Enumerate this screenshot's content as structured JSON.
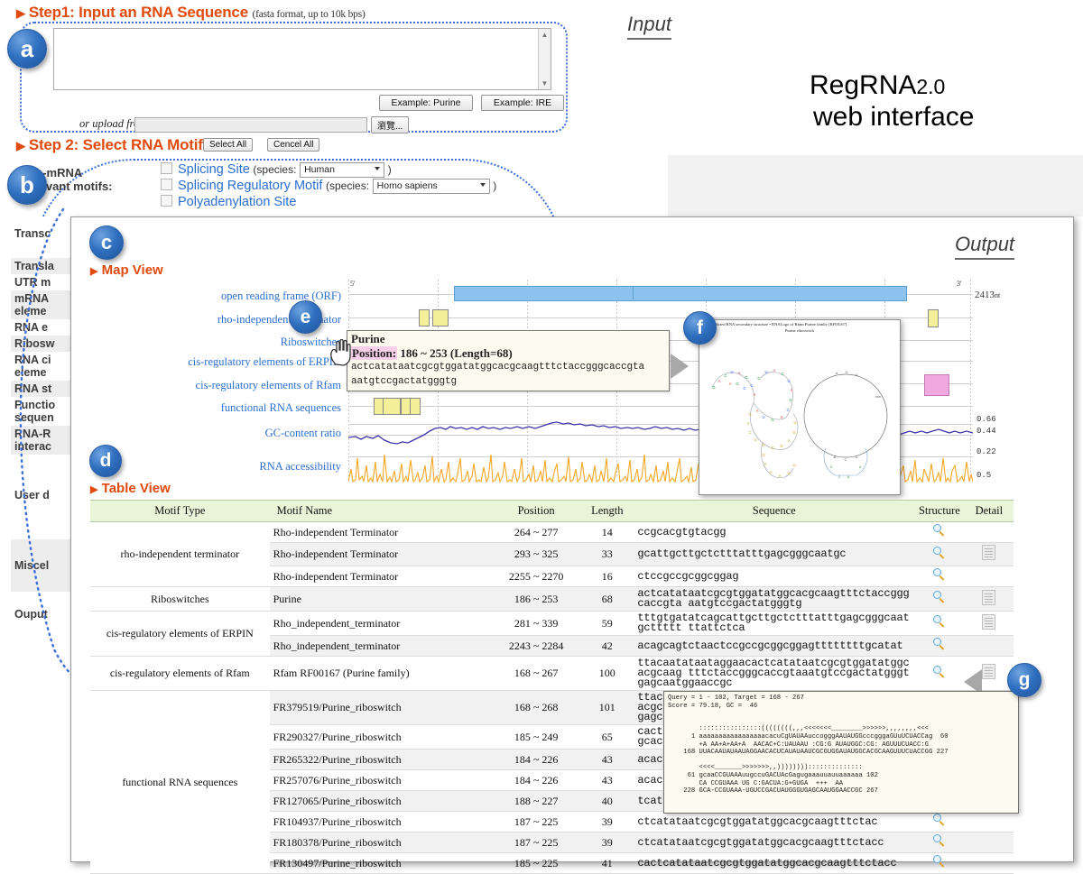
{
  "page": {
    "brand_line1": "RegRNA",
    "brand_version": "2.0",
    "brand_line2": "web interface",
    "input_header": "Input",
    "output_header": "Output"
  },
  "step1": {
    "triangle": "▶",
    "title": "Step1: Input an RNA Sequence",
    "note": "(fasta format, up to 10k bps)",
    "textarea_value": "",
    "textarea_placeholder": "",
    "example_purine": "Example: Purine",
    "example_ire": "Example: IRE",
    "upload_label": "or upload from:",
    "upload_value": "",
    "browse_button": "瀏覽..."
  },
  "step2": {
    "triangle": "▶",
    "title": "Step 2: Select RNA Motifs",
    "select_all": "Select All",
    "cancel_all": "Cencel All",
    "group_label_line1": "e-mRNA",
    "group_label_line2": "levant motifs:",
    "motifs": [
      {
        "label": "Splicing Site",
        "species_prefix": "(species:",
        "species_value": "Human",
        "species_suffix": ")",
        "checked": false
      },
      {
        "label": "Splicing Regulatory Motif",
        "species_prefix": "(species:",
        "species_value": "Homo sapiens",
        "species_suffix": ")",
        "checked": false
      },
      {
        "label": "Polyadenylation Site",
        "species_prefix": "",
        "species_value": "",
        "species_suffix": "",
        "checked": false
      }
    ]
  },
  "sidebar": {
    "items": [
      {
        "label": "Transc",
        "shaded": false
      },
      {
        "label": "Transla",
        "shaded": true
      },
      {
        "label": "UTR m",
        "shaded": false
      },
      {
        "label": "mRNA\neleme",
        "shaded": true
      },
      {
        "label": "RNA e",
        "shaded": false
      },
      {
        "label": "Ribosw",
        "shaded": true
      },
      {
        "label": "RNA ci\neleme",
        "shaded": false
      },
      {
        "label": "RNA st",
        "shaded": true
      },
      {
        "label": "Functio\nsequen",
        "shaded": false
      },
      {
        "label": "RNA-R\ninterac",
        "shaded": true
      },
      {
        "label": "User d",
        "shaded": false
      },
      {
        "label": "Miscel",
        "shaded": true
      },
      {
        "label": "Ouput",
        "shaded": false
      }
    ]
  },
  "badges": [
    {
      "id": "a",
      "letter": "a"
    },
    {
      "id": "b",
      "letter": "b"
    },
    {
      "id": "c",
      "letter": "c"
    },
    {
      "id": "d",
      "letter": "d"
    },
    {
      "id": "e",
      "letter": "e"
    },
    {
      "id": "f",
      "letter": "f"
    },
    {
      "id": "g",
      "letter": "g"
    }
  ],
  "map_view": {
    "triangle": "▶",
    "title": "Map View",
    "five_prime": "5'",
    "three_prime": "3'",
    "length_label": "2413",
    "length_unit": "nt",
    "tracks": [
      {
        "name": "open reading frame (ORF)"
      },
      {
        "name": "rho-independent terminator"
      },
      {
        "name": "Riboswitches"
      },
      {
        "name": "cis-regulatory elements of ERPIN"
      },
      {
        "name": "cis-regulatory elements of Rfam"
      },
      {
        "name": "functional RNA sequences"
      },
      {
        "name": "GC-content ratio"
      },
      {
        "name": "RNA accessibility"
      }
    ],
    "gc_axis_ticks": [
      "0.66",
      "0.44",
      "0.22"
    ],
    "access_axis_ticks": [
      "0.5"
    ],
    "feature_colors": {
      "orf": "#8dc3ee",
      "terminator": "#f4f09a",
      "riboswitch": "#2ee0e8",
      "erpin": "#f2706e",
      "rfam": "#f0a8e0",
      "functional": "#f4f09a",
      "gc_line": "#3b34a8",
      "accessibility": "#f5a623"
    }
  },
  "tooltip_e": {
    "title": "Purine",
    "position_label": "Position:",
    "position_value": "186 ~ 253",
    "length_text": "(Length=68)",
    "sequence_line1": "actcatataatcgcgtggatatggcacgcaagtttctaccgggcaccgta",
    "sequence_line2": "aatgtccgactatgggtg"
  },
  "popup_f": {
    "header": "...of predicted RNA secondary structure   • RNALogo of Rfam Purine family (RF00167)",
    "subheader": "Purine riboswitch"
  },
  "popup_g": {
    "text": "Query = 1 - 102, Target = 168 - 267\nScore = 79.18, GC =  46\n\n\n        ::::::::::::::::((((((((,,,<<<<<<<________>>>>>>,,,,,,,,<<<\n      1 aaaaaaaaaaaaaaaaacacuCgUAUAAuccogggAAUAUGGcccgggaGUuUCUACCag  60\n        +A AA+A+AA+A  AACAC+C:UAUAAU :CG:G AUAUGGC:CG: AGUUUCUACC:G\n    168 UUACAAUAUAAUAGGAACACUCAUAUAAUCGCGUGGAUAUGGCACGCAAGUUUCUACCGG 227\n\n        <<<<_______>>>>>>>,,))))))))::::::::::::::\n     61 gcaaCCGUAAAuugccuGACUAcGagugaaauuauuaaaaaa 102\n        CA CCGUAAA UG C:GACUA:G+GUGA  +++  AA\n    228 GCA-CCGUAAA-UGUCCGACUAUGGGUGAGCAAUGGAACCGC 267"
  },
  "table_view": {
    "triangle": "▶",
    "title": "Table View",
    "columns": [
      "Motif Type",
      "Motif Name",
      "Position",
      "Length",
      "Sequence",
      "Structure",
      "Detail"
    ],
    "groups": [
      {
        "type": "rho-independent terminator",
        "rows": [
          {
            "name": "Rho-independent Terminator",
            "position": "264 ~ 277",
            "length": "14",
            "sequence": "ccgcacgtgtacgg",
            "structure": true,
            "detail": false
          },
          {
            "name": "Rho-independent Terminator",
            "position": "293 ~ 325",
            "length": "33",
            "sequence": "gcattgcttgctctttatttgagcgggcaatgc",
            "structure": true,
            "detail": true
          },
          {
            "name": "Rho-independent Terminator",
            "position": "2255 ~ 2270",
            "length": "16",
            "sequence": "ctccgccgcggcggag",
            "structure": true,
            "detail": false
          }
        ]
      },
      {
        "type": "Riboswitches",
        "rows": [
          {
            "name": "Purine",
            "position": "186 ~ 253",
            "length": "68",
            "sequence": "actcatataatcgcgtggatatggcacgcaagtttctaccgggcaccgta aatgtccgactatgggtg",
            "structure": true,
            "detail": true
          }
        ]
      },
      {
        "type": "cis-regulatory elements of ERPIN",
        "rows": [
          {
            "name": "Rho_independent_terminator",
            "position": "281 ~ 339",
            "length": "59",
            "sequence": "tttgtgatatcagcattgcttgctctttatttgagcgggcaatgcttttt ttattctca",
            "structure": true,
            "detail": true
          },
          {
            "name": "Rho_independent_terminator",
            "position": "2243 ~ 2284",
            "length": "42",
            "sequence": "acagcagtctaactccgccgcggcggagttttttttgcatat",
            "structure": true,
            "detail": false
          }
        ]
      },
      {
        "type": "cis-regulatory elements of Rfam",
        "rows": [
          {
            "name": "Rfam RF00167 (Purine family)",
            "position": "168 ~ 267",
            "length": "100",
            "sequence": "ttacaatataataggaacactcatataatcgcgtggatatggcacgcaag tttctaccgggcaccgtaaatgtccgactatgggtgagcaatggaaccgc",
            "structure": true,
            "detail": true
          }
        ]
      },
      {
        "type": "functional RNA sequences",
        "rows": [
          {
            "name": "FR379519/Purine_riboswitch",
            "position": "168 ~ 268",
            "length": "101",
            "sequence": "ttacaatataataggaacactcatataatcgcgtggatatggcacgcaag tttctaccgggcaccgtaaatgtccgactatgggtgagcaatggaaccgc a",
            "structure": true,
            "detail": true
          },
          {
            "name": "FR290327/Purine_riboswitch",
            "position": "185 ~ 249",
            "length": "65",
            "sequence": "cactcatataatcgcgtggatatggcacgcaagtttctaccgggcaccgt aaatgtccgactatggg",
            "structure": true,
            "detail": false
          },
          {
            "name": "FR265322/Purine_riboswitch",
            "position": "184 ~ 226",
            "length": "43",
            "sequence": "acactcatataatcgcgtggatatggcacgcaagtttctacc",
            "structure": true,
            "detail": false
          },
          {
            "name": "FR257076/Purine_riboswitch",
            "position": "184 ~ 226",
            "length": "43",
            "sequence": "acactcatataatcgcgtggatatggcacgcaagtttctacc",
            "structure": true,
            "detail": false
          },
          {
            "name": "FR127065/Purine_riboswitch",
            "position": "188 ~ 227",
            "length": "40",
            "sequence": "tcatataatcgcgtggatatggcacgcaagtttctaccg",
            "structure": true,
            "detail": false
          },
          {
            "name": "FR104937/Purine_riboswitch",
            "position": "187 ~ 225",
            "length": "39",
            "sequence": "ctcatataatcgcgtggatatggcacgcaagtttctac",
            "structure": true,
            "detail": false
          },
          {
            "name": "FR180378/Purine_riboswitch",
            "position": "187 ~ 225",
            "length": "39",
            "sequence": "ctcatataatcgcgtggatatggcacgcaagtttctacc",
            "structure": true,
            "detail": false
          },
          {
            "name": "FR130497/Purine_riboswitch",
            "position": "185 ~ 225",
            "length": "41",
            "sequence": "cactcatataatcgcgtggatatggcacgcaagtttctacc",
            "structure": true,
            "detail": false
          }
        ]
      }
    ]
  }
}
